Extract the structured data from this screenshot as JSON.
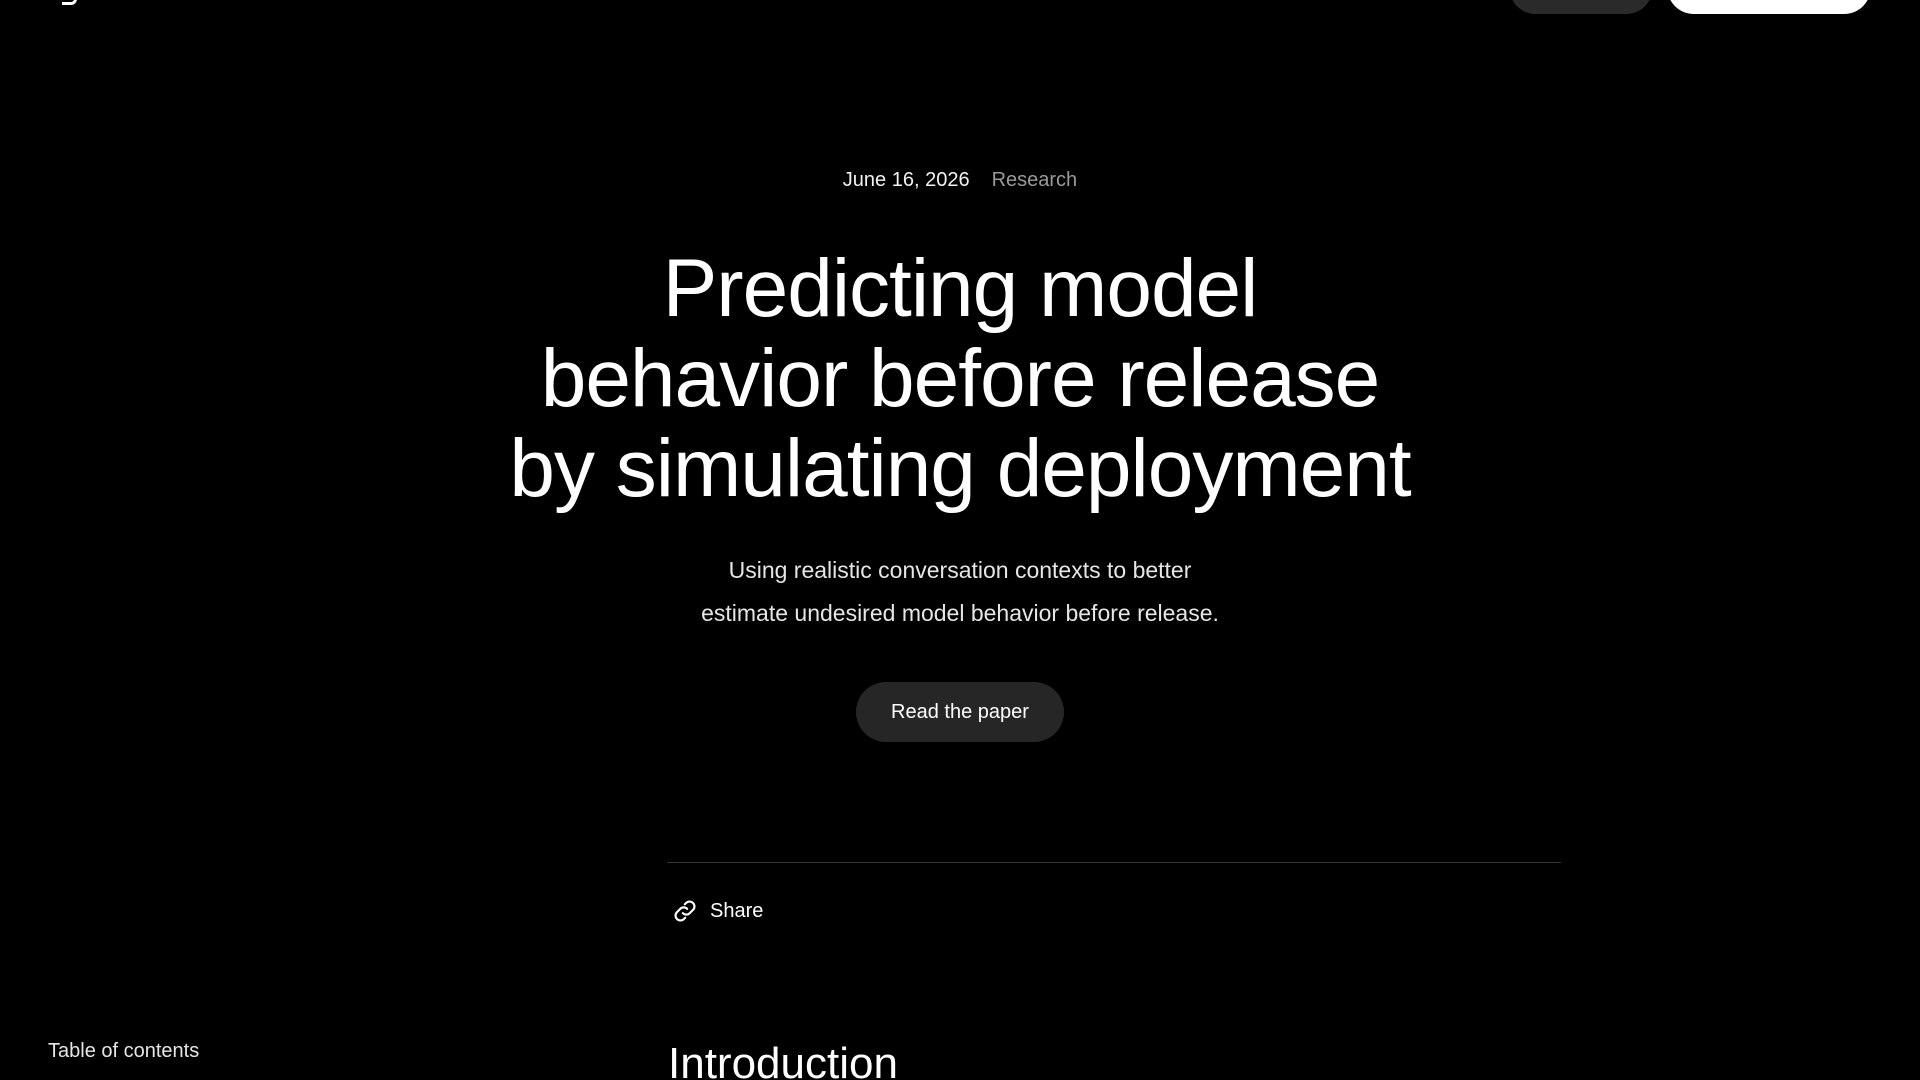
{
  "meta": {
    "date": "June 16, 2026",
    "category": "Research"
  },
  "article": {
    "title_lines": [
      "Predicting model",
      "behavior before release",
      "by simulating deployment"
    ],
    "subtitle_lines": [
      "Using realistic conversation contexts to better",
      "estimate undesired model behavior before release."
    ],
    "cta_label": "Read the paper"
  },
  "share": {
    "label": "Share",
    "icon": "link-icon"
  },
  "sidebar": {
    "toc_label": "Table of contents"
  },
  "content": {
    "first_heading": "Introduction"
  },
  "colors": {
    "background": "#000000",
    "text": "#ffffff",
    "muted": "#9a9a9a",
    "button_bg": "#262626",
    "divider": "#333333"
  }
}
